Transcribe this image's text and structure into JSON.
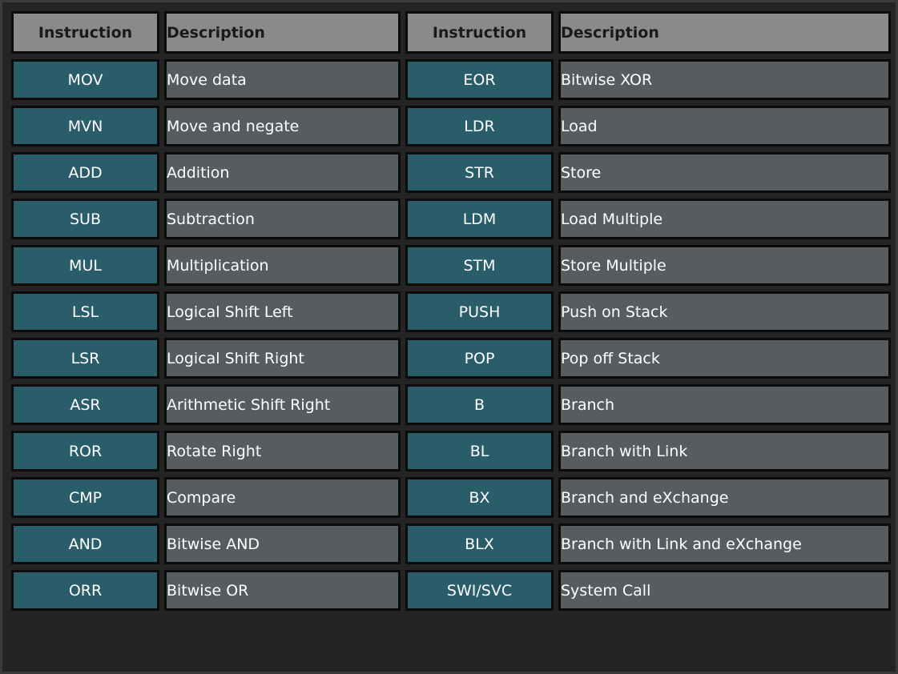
{
  "headers": [
    "Instruction",
    "Description",
    "Instruction",
    "Description"
  ],
  "rows": [
    [
      "MOV",
      "Move data",
      "EOR",
      "Bitwise XOR"
    ],
    [
      "MVN",
      "Move and negate",
      "LDR",
      "Load"
    ],
    [
      "ADD",
      "Addition",
      "STR",
      "Store"
    ],
    [
      "SUB",
      "Subtraction",
      "LDM",
      "Load Multiple"
    ],
    [
      "MUL",
      "Multiplication",
      "STM",
      "Store Multiple"
    ],
    [
      "LSL",
      "Logical Shift Left",
      "PUSH",
      "Push on Stack"
    ],
    [
      "LSR",
      "Logical Shift Right",
      "POP",
      "Pop off Stack"
    ],
    [
      "ASR",
      "Arithmetic Shift Right",
      "B",
      "Branch"
    ],
    [
      "ROR",
      "Rotate Right",
      "BL",
      "Branch with Link"
    ],
    [
      "CMP",
      "Compare",
      "BX",
      "Branch and eXchange"
    ],
    [
      "AND",
      "Bitwise AND",
      "BLX",
      "Branch with Link and eXchange"
    ],
    [
      "ORR",
      "Bitwise OR",
      "SWI/SVC",
      "System Call"
    ]
  ],
  "colors": {
    "background": "#242424",
    "header_cell": "#8a8a8a",
    "instruction_cell": "#295d69",
    "description_cell": "#565c60",
    "cell_border": "#0b0b0b",
    "text": "#ffffff"
  }
}
